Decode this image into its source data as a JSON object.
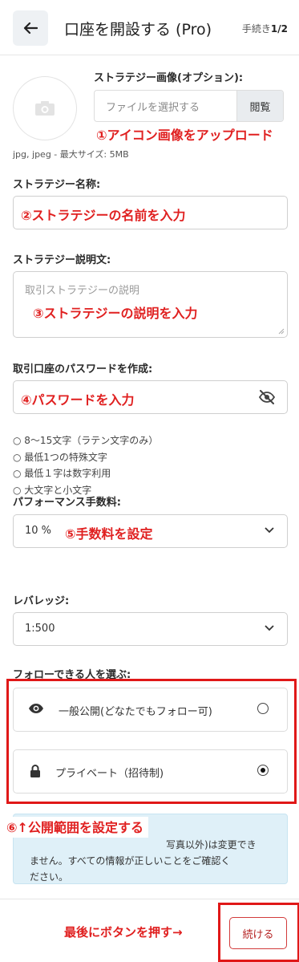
{
  "header": {
    "title": "口座を開設する (Pro)",
    "step_label": "手続き",
    "step_value": "1/2"
  },
  "strategy_image": {
    "label": "ストラテジー画像(オプション):",
    "file_placeholder": "ファイルを選択する",
    "browse_label": "閲覧",
    "hint": "jpg, jpeg - 最大サイズ: 5MB",
    "annotation": "①アイコン画像をアップロード"
  },
  "strategy_name": {
    "label": "ストラテジー名称:",
    "annotation": "②ストラテジーの名前を入力"
  },
  "strategy_description": {
    "label": "ストラテジー説明文:",
    "placeholder": "取引ストラテジーの説明",
    "annotation": "③ストラテジーの説明を入力"
  },
  "password": {
    "label": "取引口座のパスワードを作成:",
    "annotation": "④パスワードを入力",
    "requirements": [
      "8〜15文字（ラテン文字のみ）",
      "最低1つの特殊文字",
      "最低１字は数字利用",
      "大文字と小文字"
    ]
  },
  "performance_fee": {
    "label": "パフォーマンス手数料:",
    "value": "10 %",
    "annotation": "⑤手数料を設定"
  },
  "leverage": {
    "label": "レバレッジ:",
    "value": "1:500"
  },
  "followers": {
    "label": "フォローできる人を選ぶ:",
    "options": [
      {
        "label": "一般公開(どなたでもフォロー可)",
        "selected": false
      },
      {
        "label": "プライベート（招待制)",
        "selected": true
      }
    ],
    "annotation": "⑥↑公開範囲を設定する"
  },
  "notice": {
    "text_line1": "写真以外)は変更でき",
    "text_line2": "ません。すべての情報が正しいことをご確認く",
    "text_line3": "ださい。"
  },
  "footer": {
    "annotation": "最後にボタンを押す→",
    "continue_label": "続ける"
  },
  "colors": {
    "accent_red": "#e01818",
    "notice_bg": "#dff0f8"
  }
}
